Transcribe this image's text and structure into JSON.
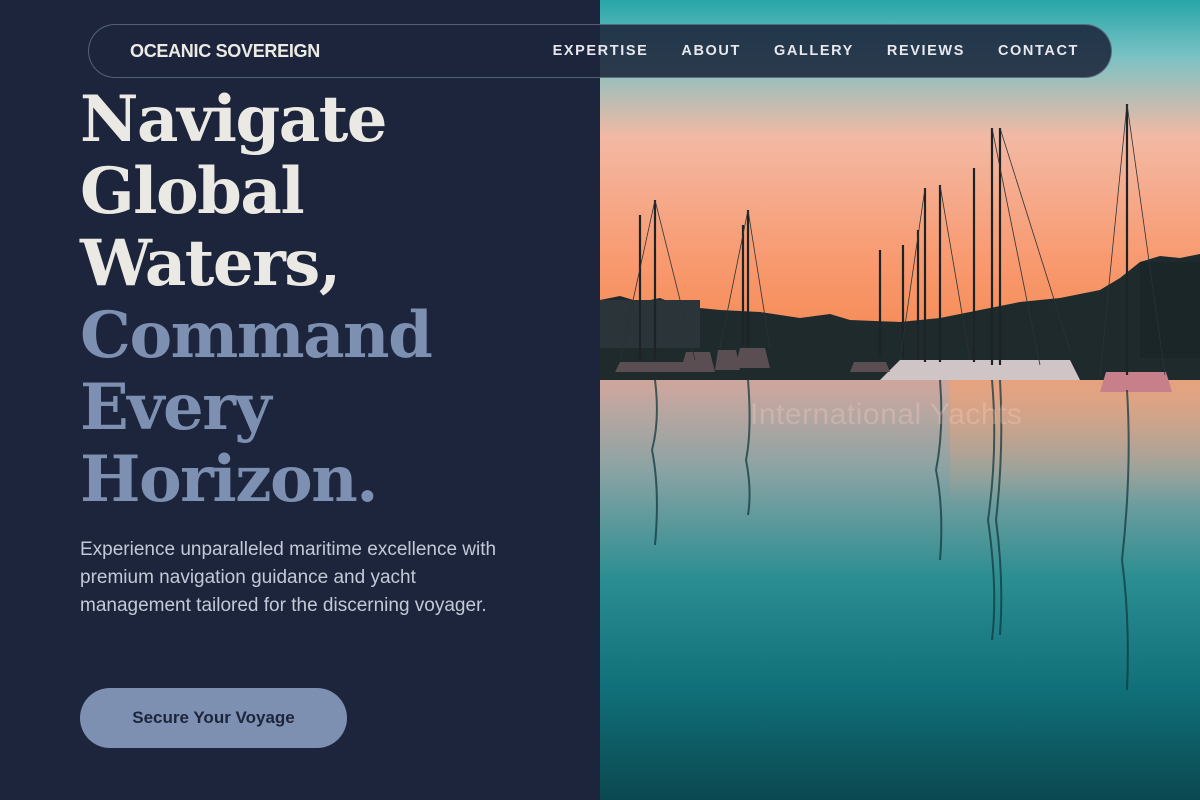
{
  "nav": {
    "brand": "OCEANIC SOVEREIGN",
    "links": [
      "EXPERTISE",
      "ABOUT",
      "GALLERY",
      "REVIEWS",
      "CONTACT"
    ]
  },
  "hero": {
    "headline_light": [
      "Navigate",
      "Global",
      "Waters,"
    ],
    "headline_accent": [
      "Command",
      "Every",
      "Horizon."
    ],
    "subtext": "Experience unparalleled maritime excellence with premium navigation guidance and yacht management tailored for the discerning voyager.",
    "cta_label": "Secure Your Voyage"
  },
  "image": {
    "watermark": "International Yachts"
  },
  "colors": {
    "background": "#1c253b",
    "headline_light": "#ebe9e4",
    "accent": "#7d90b2",
    "body_text": "#c3c9d6"
  }
}
